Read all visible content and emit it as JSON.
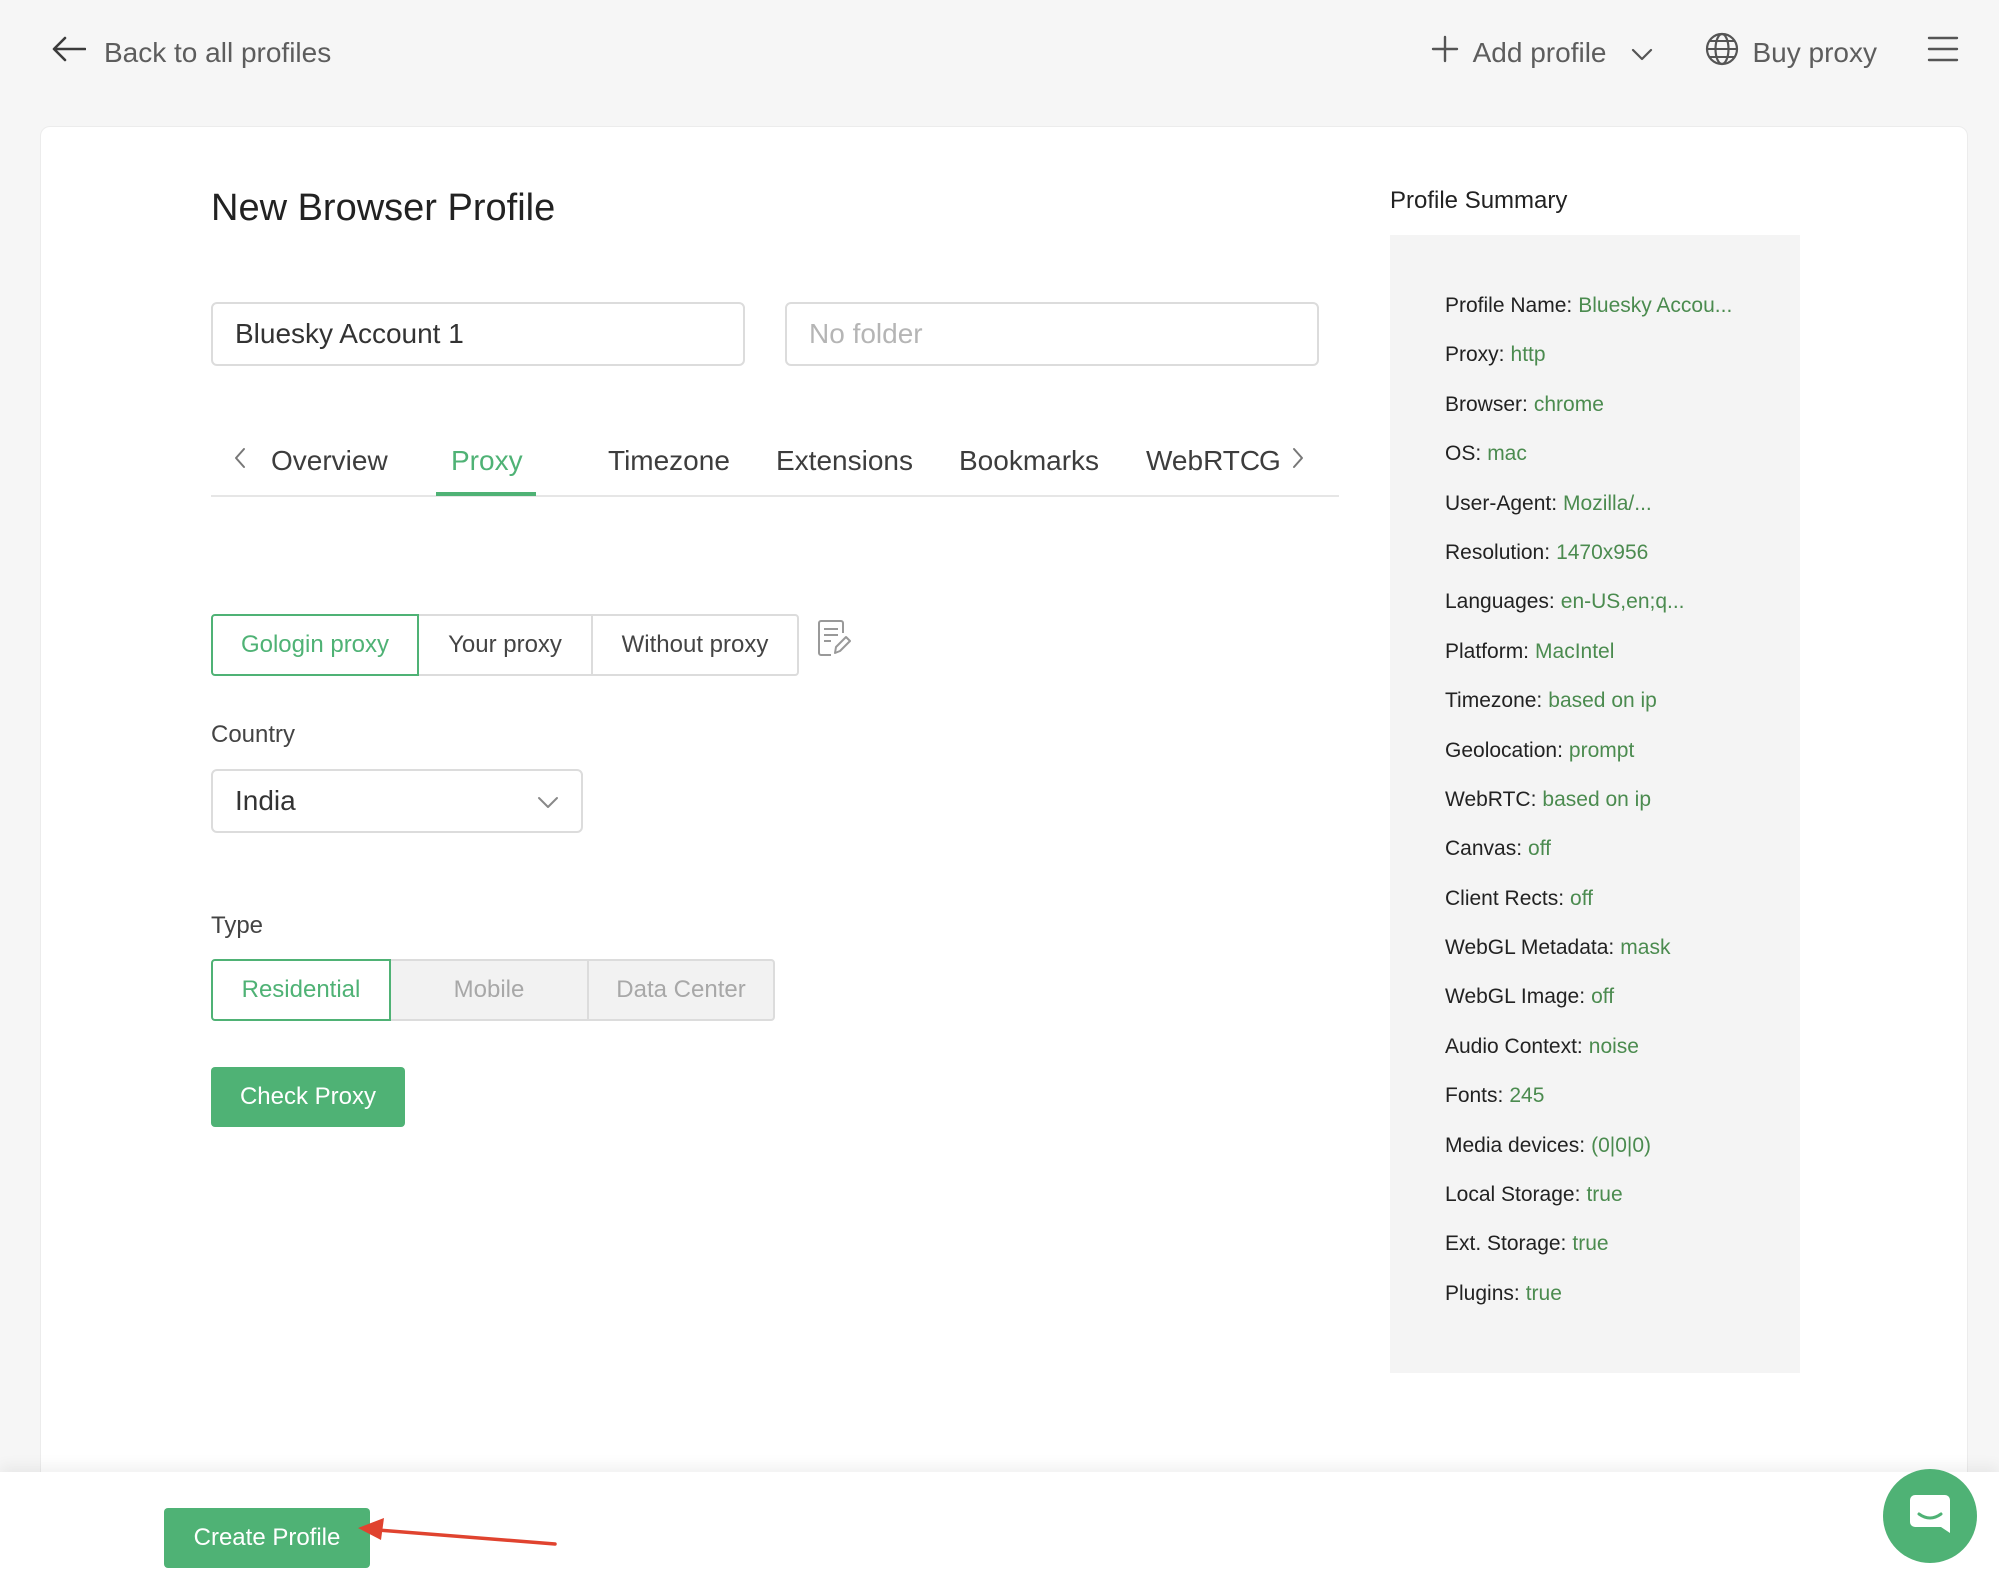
{
  "topbar": {
    "back_label": "Back to all profiles",
    "add_profile_label": "Add profile",
    "buy_proxy_label": "Buy proxy"
  },
  "page": {
    "title": "New Browser Profile"
  },
  "form": {
    "profile_name_value": "Bluesky Account 1",
    "folder_placeholder": "No folder"
  },
  "tabs": [
    {
      "label": "Overview",
      "active": false
    },
    {
      "label": "Proxy",
      "active": true
    },
    {
      "label": "Timezone",
      "active": false
    },
    {
      "label": "Extensions",
      "active": false
    },
    {
      "label": "Bookmarks",
      "active": false
    },
    {
      "label": "WebRTC",
      "active": false
    },
    {
      "label": "G",
      "active": false
    }
  ],
  "proxy_mode": {
    "options": [
      "Gologin proxy",
      "Your proxy",
      "Without proxy"
    ],
    "selected": "Gologin proxy"
  },
  "country": {
    "label": "Country",
    "value": "India"
  },
  "type": {
    "label": "Type",
    "options": [
      "Residential",
      "Mobile",
      "Data Center"
    ],
    "selected": "Residential"
  },
  "buttons": {
    "check_proxy": "Check Proxy",
    "create_profile": "Create Profile"
  },
  "summary": {
    "title": "Profile Summary",
    "rows": [
      {
        "key": "Profile Name:",
        "value": "Bluesky Accou..."
      },
      {
        "key": "Proxy:",
        "value": "http"
      },
      {
        "key": "Browser:",
        "value": "chrome"
      },
      {
        "key": "OS:",
        "value": "mac"
      },
      {
        "key": "User-Agent:",
        "value": "Mozilla/..."
      },
      {
        "key": "Resolution:",
        "value": "1470x956"
      },
      {
        "key": "Languages:",
        "value": "en-US,en;q..."
      },
      {
        "key": "Platform:",
        "value": "MacIntel"
      },
      {
        "key": "Timezone:",
        "value": "based on ip"
      },
      {
        "key": "Geolocation:",
        "value": "prompt"
      },
      {
        "key": "WebRTC:",
        "value": "based on ip"
      },
      {
        "key": "Canvas:",
        "value": "off"
      },
      {
        "key": "Client Rects:",
        "value": "off"
      },
      {
        "key": "WebGL Metadata:",
        "value": "mask"
      },
      {
        "key": "WebGL Image:",
        "value": "off"
      },
      {
        "key": "Audio Context:",
        "value": "noise"
      },
      {
        "key": "Fonts:",
        "value": "245"
      },
      {
        "key": "Media devices:",
        "value": "(0|0|0)"
      },
      {
        "key": "Local Storage:",
        "value": "true"
      },
      {
        "key": "Ext. Storage:",
        "value": "true"
      },
      {
        "key": "Plugins:",
        "value": "true"
      }
    ]
  },
  "colors": {
    "accent": "#4fb275",
    "summary_value": "#4b8b4f",
    "annotation_arrow": "#e0432f"
  }
}
